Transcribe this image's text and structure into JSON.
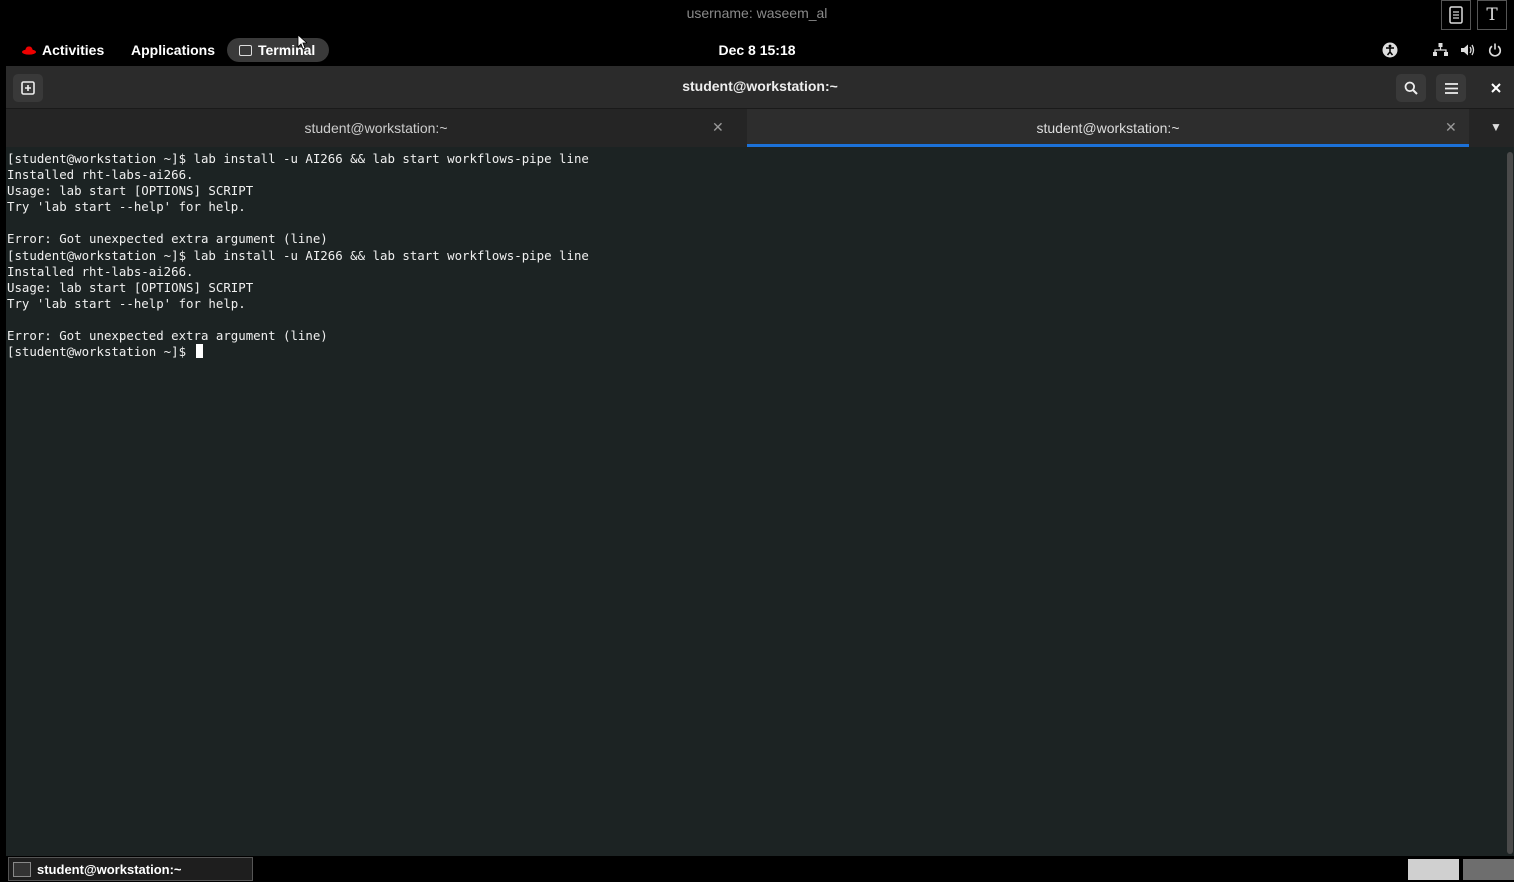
{
  "session": {
    "username": "username: waseem_al",
    "buttons": [
      {
        "icon": "clipboard-icon"
      },
      {
        "label": "T"
      }
    ]
  },
  "topbar": {
    "activities": "Activities",
    "applications": "Applications",
    "active_app": "Terminal",
    "clock": "Dec 8  15:18",
    "tray_icons": [
      "accessibility-icon",
      "network-icon",
      "volume-icon",
      "power-icon"
    ]
  },
  "window": {
    "title": "student@workstation:~",
    "tabs": [
      {
        "label": "student@workstation:~",
        "active": false
      },
      {
        "label": "student@workstation:~",
        "active": true
      }
    ]
  },
  "terminal": {
    "lines": [
      "[student@workstation ~]$ lab install -u AI266 && lab start workflows-pipe line",
      "Installed rht-labs-ai266.",
      "Usage: lab start [OPTIONS] SCRIPT",
      "Try 'lab start --help' for help.",
      "",
      "Error: Got unexpected extra argument (line)",
      "[student@workstation ~]$ lab install -u AI266 && lab start workflows-pipe line",
      "Installed rht-labs-ai266.",
      "Usage: lab start [OPTIONS] SCRIPT",
      "Try 'lab start --help' for help.",
      "",
      "Error: Got unexpected extra argument (line)"
    ],
    "prompt": "[student@workstation ~]$ "
  },
  "taskbar": {
    "window_item": "student@workstation:~"
  },
  "colors": {
    "accent": "#1c71d8",
    "terminal_bg": "#1c2323",
    "redhat": "#ee0000"
  }
}
